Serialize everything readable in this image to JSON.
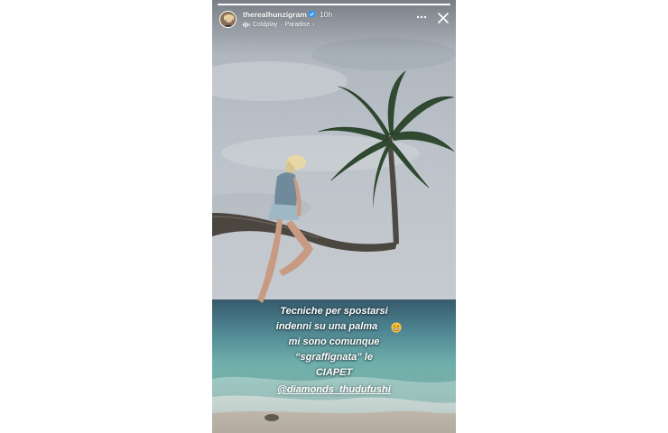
{
  "story": {
    "username": "therealhunzigram",
    "time_ago": "10h",
    "progress_fraction": 1.0
  },
  "music": {
    "artist": "Coldplay",
    "separator": "·",
    "song": "Paradise",
    "chevron": "›"
  },
  "icons": {
    "verified": "verified-badge-icon",
    "music": "music-bars-icon",
    "more": "more-options-icon",
    "close": "close-icon",
    "emoji": "grimacing-face-icon"
  },
  "caption": {
    "lines": [
      "Tecniche per spostarsi",
      "indenni su una palma",
      "mi sono comunque",
      "“sgraffignata” le",
      "CIAPET"
    ],
    "mention": "@diamonds_thudufushi"
  },
  "colors": {
    "verified_badge": "#3897f0",
    "text": "#ffffff",
    "sky": "#b9bfc6",
    "sea": "#6fa7a8"
  }
}
